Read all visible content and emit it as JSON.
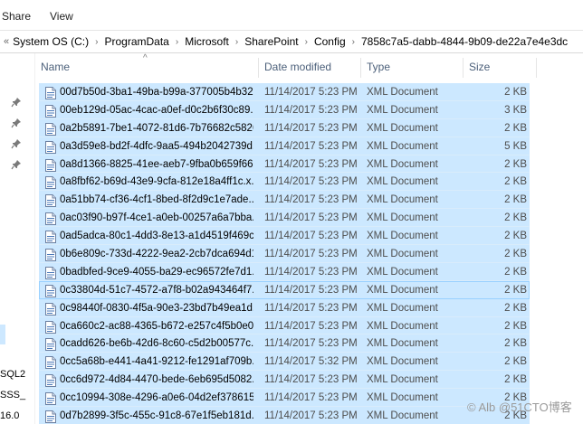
{
  "ribbon": {
    "tabs": [
      "Share",
      "View"
    ]
  },
  "address": {
    "crumbs": [
      "System OS (C:)",
      "ProgramData",
      "Microsoft",
      "SharePoint",
      "Config",
      "7858c7a5-dabb-4844-9b09-de22a7e4e3dc"
    ]
  },
  "nav": {
    "items": [
      "SQL2",
      "SSS_",
      "16.0"
    ]
  },
  "columns": {
    "name": "Name",
    "date": "Date modified",
    "type": "Type",
    "size": "Size"
  },
  "files": [
    {
      "name": "00d7b50d-3ba1-49ba-b99a-377005b4b32...",
      "date": "11/14/2017 5:23 PM",
      "type": "XML Document",
      "size": "2 KB"
    },
    {
      "name": "00eb129d-05ac-4cac-a0ef-d0c2b6f30c89....",
      "date": "11/14/2017 5:23 PM",
      "type": "XML Document",
      "size": "3 KB"
    },
    {
      "name": "0a2b5891-7be1-4072-81d6-7b76682c5826...",
      "date": "11/14/2017 5:23 PM",
      "type": "XML Document",
      "size": "2 KB"
    },
    {
      "name": "0a3d59e8-bd2f-4dfc-9aa5-494b2042739d....",
      "date": "11/14/2017 5:23 PM",
      "type": "XML Document",
      "size": "5 KB"
    },
    {
      "name": "0a8d1366-8825-41ee-aeb7-9fba0b659f66....",
      "date": "11/14/2017 5:23 PM",
      "type": "XML Document",
      "size": "2 KB"
    },
    {
      "name": "0a8fbf62-b69d-43e9-9cfa-812e18a4ff1c.x...",
      "date": "11/14/2017 5:23 PM",
      "type": "XML Document",
      "size": "2 KB"
    },
    {
      "name": "0a51bb74-cf36-4cf1-8bed-8f2d9c1e7ade....",
      "date": "11/14/2017 5:23 PM",
      "type": "XML Document",
      "size": "2 KB"
    },
    {
      "name": "0ac03f90-b97f-4ce1-a0eb-00257a6a7bba....",
      "date": "11/14/2017 5:23 PM",
      "type": "XML Document",
      "size": "2 KB"
    },
    {
      "name": "0ad5adca-80c1-4dd3-8e13-a1d4519f469c....",
      "date": "11/14/2017 5:23 PM",
      "type": "XML Document",
      "size": "2 KB"
    },
    {
      "name": "0b6e809c-733d-4222-9ea2-2cb7dca694d1....",
      "date": "11/14/2017 5:23 PM",
      "type": "XML Document",
      "size": "2 KB"
    },
    {
      "name": "0badbfed-9ce9-4055-ba29-ec96572fe7d1....",
      "date": "11/14/2017 5:23 PM",
      "type": "XML Document",
      "size": "2 KB"
    },
    {
      "name": "0c33804d-51c7-4572-a7f8-b02a943464f7....",
      "date": "11/14/2017 5:23 PM",
      "type": "XML Document",
      "size": "2 KB"
    },
    {
      "name": "0c98440f-0830-4f5a-90e3-23bd7b49ea1d....",
      "date": "11/14/2017 5:23 PM",
      "type": "XML Document",
      "size": "2 KB"
    },
    {
      "name": "0ca660c2-ac88-4365-b672-e257c4f5b0e0....",
      "date": "11/14/2017 5:23 PM",
      "type": "XML Document",
      "size": "2 KB"
    },
    {
      "name": "0cadd626-be6b-42d6-8c60-c5d2b00577c....",
      "date": "11/14/2017 5:23 PM",
      "type": "XML Document",
      "size": "2 KB"
    },
    {
      "name": "0cc5a68b-e441-4a41-9212-fe1291af709b....",
      "date": "11/14/2017 5:32 PM",
      "type": "XML Document",
      "size": "2 KB"
    },
    {
      "name": "0cc6d972-4d84-4470-bede-6eb695d5082....",
      "date": "11/14/2017 5:23 PM",
      "type": "XML Document",
      "size": "2 KB"
    },
    {
      "name": "0cc10994-308e-4296-a0e6-04d2ef378615....",
      "date": "11/14/2017 5:23 PM",
      "type": "XML Document",
      "size": "2 KB"
    },
    {
      "name": "0d7b2899-3f5c-455c-91c8-67e1f5eb181d....",
      "date": "11/14/2017 5:23 PM",
      "type": "XML Document",
      "size": "2 KB"
    }
  ],
  "watermark": "© Alb  @51CTO博客",
  "icons": {
    "file": "xml-document-icon",
    "pin": "pin-icon"
  },
  "colors": {
    "selection": "#cce8ff",
    "header_text": "#4c607a"
  }
}
